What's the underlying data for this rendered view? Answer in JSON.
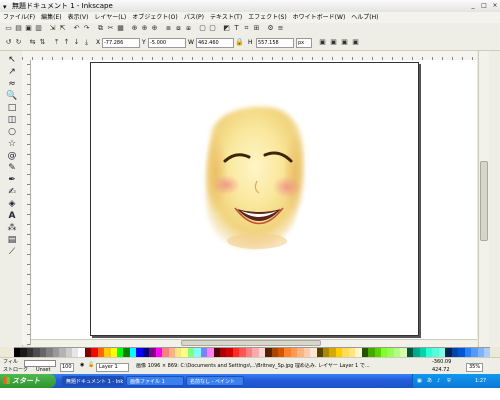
{
  "window": {
    "title": "無題ドキュメント 1 - Inkscape",
    "buttons": [
      "_",
      "□",
      "×"
    ]
  },
  "menubar": {
    "items": [
      "ファイル(F)",
      "編集(E)",
      "表示(V)",
      "レイヤー(L)",
      "オブジェクト(O)",
      "パス(P)",
      "テキスト(T)",
      "エフェクト(S)",
      "ホワイトボード(W)",
      "ヘルプ(H)"
    ]
  },
  "controls": {
    "x_label": "X",
    "x_value": "-77.286",
    "y_label": "Y",
    "y_value": "-5.000",
    "w_label": "W",
    "w_value": "462.460",
    "h_label": "H",
    "h_value": "557.158",
    "unit": "px"
  },
  "status": {
    "fill_label": "フィル",
    "stroke_label": "ストローク",
    "fill_value": "Unset",
    "stroke_value": "Unset",
    "opacity_value": "100",
    "layer_value": "Layer 1",
    "message": "画像 1096 × 869: C:\\Documents and Settings\\...\\Britney_Sp.jpg 埋め込み. レイヤー Layer 1 で...",
    "x_coord": "-360.09",
    "y_coord": "424.72",
    "zoom": "35%"
  },
  "taskbar": {
    "start_label": "スタート",
    "tasks": [
      "無題ドキュメント 1 - Inkscape",
      "画像ファイル 1",
      "名前なし - ペイント"
    ],
    "tray_time": "1:27"
  },
  "colors": {
    "palette": [
      "#000000",
      "#1a1a1a",
      "#333333",
      "#4d4d4d",
      "#666666",
      "#808080",
      "#999999",
      "#b3b3b3",
      "#cccccc",
      "#e6e6e6",
      "#ffffff",
      "#800000",
      "#ff0000",
      "#ff6600",
      "#ffcc00",
      "#ffff00",
      "#00ff00",
      "#008000",
      "#00ffff",
      "#0000ff",
      "#000080",
      "#800080",
      "#ff00ff",
      "#ff8080",
      "#ffb380",
      "#ffe680",
      "#ffff80",
      "#80ff80",
      "#80ffff",
      "#8080ff",
      "#ff80ff",
      "#550000",
      "#aa0000",
      "#d40000",
      "#ff2a2a",
      "#ff5555",
      "#ff8080",
      "#ffaaaa",
      "#ffd5d5",
      "#552200",
      "#aa4400",
      "#d45500",
      "#ff7f2a",
      "#ff9955",
      "#ffb380",
      "#ffccaa",
      "#ffe6d5",
      "#554400",
      "#aa8800",
      "#d4aa00",
      "#ffcc00",
      "#ffdd55",
      "#ffe680",
      "#fff6d5",
      "#225500",
      "#44aa00",
      "#55d400",
      "#7fff2a",
      "#99ff55",
      "#b3ff80",
      "#d5ffaa",
      "#005544",
      "#00aa88",
      "#00d4aa",
      "#2affd5",
      "#55ffdd",
      "#80ffe6",
      "#002255",
      "#0044aa",
      "#0055d4",
      "#2a7fff",
      "#5599ff",
      "#80b3ff",
      "#aaccff"
    ]
  }
}
